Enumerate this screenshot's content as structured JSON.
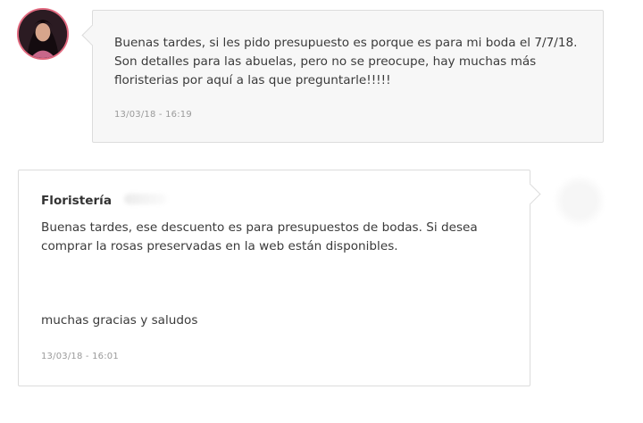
{
  "messages": [
    {
      "role": "client",
      "text": "Buenas tardes, si les pido presupuesto es porque es para mi boda el 7/7/18. Son detalles para las abuelas, pero no se preocupe, hay muchas más floristerias por aquí a las que preguntarle!!!!!",
      "timestamp": "13/03/18 - 16:19"
    },
    {
      "role": "vendor",
      "sender": "Floristería",
      "text": "Buenas tardes, ese descuento es para presupuestos de bodas. Si desea comprar la rosas preservadas en la web están disponibles.",
      "text_2": "muchas gracias y saludos",
      "timestamp": "13/03/18 - 16:01"
    }
  ],
  "colors": {
    "client_bubble_bg": "#f7f7f7",
    "vendor_bubble_bg": "#ffffff",
    "border": "#dcdcdc",
    "avatar_ring": "#e0687e",
    "timestamp": "#9a9a9a"
  }
}
